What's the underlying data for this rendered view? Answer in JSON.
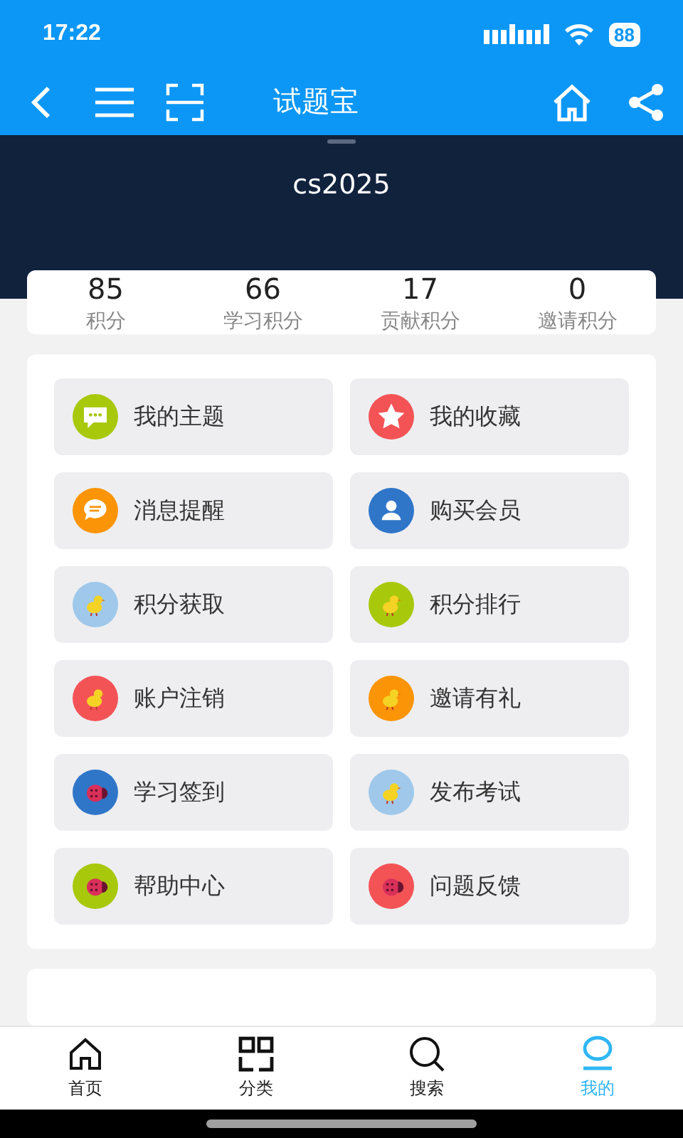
{
  "status_bar": {
    "time": "17:22",
    "battery": "88"
  },
  "nav_bar": {
    "title": "试题宝"
  },
  "profile": {
    "username": "cs2025"
  },
  "stats": [
    {
      "value": "85",
      "label": "积分"
    },
    {
      "value": "66",
      "label": "学习积分"
    },
    {
      "value": "17",
      "label": "贡献积分"
    },
    {
      "value": "0",
      "label": "邀请积分"
    }
  ],
  "menu": [
    {
      "label": "我的主题",
      "kind": "chat",
      "color": "#a8c80c"
    },
    {
      "label": "我的收藏",
      "kind": "star",
      "color": "#f45356"
    },
    {
      "label": "消息提醒",
      "kind": "message",
      "color": "#fb9406"
    },
    {
      "label": "购买会员",
      "kind": "person",
      "color": "#2f76c9"
    },
    {
      "label": "积分获取",
      "kind": "chick",
      "color": "#9fc8ea"
    },
    {
      "label": "积分排行",
      "kind": "chick",
      "color": "#a8c80c"
    },
    {
      "label": "账户注销",
      "kind": "chick",
      "color": "#f45356"
    },
    {
      "label": "邀请有礼",
      "kind": "chick",
      "color": "#fb9406"
    },
    {
      "label": "学习签到",
      "kind": "bug",
      "color": "#2f76c9"
    },
    {
      "label": "发布考试",
      "kind": "chick",
      "color": "#9fc8ea"
    },
    {
      "label": "帮助中心",
      "kind": "bug",
      "color": "#a8c80c"
    },
    {
      "label": "问题反馈",
      "kind": "bug",
      "color": "#f45356"
    }
  ],
  "tab_bar": [
    {
      "label": "首页",
      "kind": "home",
      "selected": false
    },
    {
      "label": "分类",
      "kind": "grid",
      "selected": false
    },
    {
      "label": "搜索",
      "kind": "search",
      "selected": false
    },
    {
      "label": "我的",
      "kind": "user",
      "selected": true
    }
  ]
}
